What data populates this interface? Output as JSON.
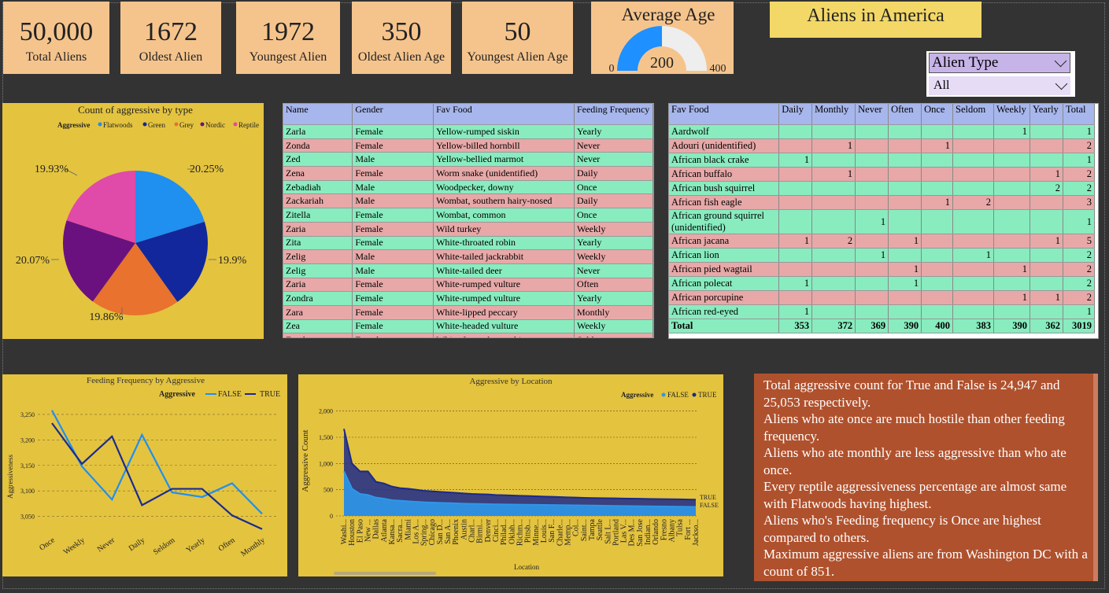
{
  "kpis": [
    {
      "value": "50,000",
      "label": "Total Aliens"
    },
    {
      "value": "1672",
      "label": "Oldest Alien"
    },
    {
      "value": "1972",
      "label": "Youngest Alien"
    },
    {
      "value": "350",
      "label": "Oldest Alien Age"
    },
    {
      "value": "50",
      "label": "Youngest Alien Age"
    }
  ],
  "gauge": {
    "title": "Average Age",
    "value": "200",
    "min": "0",
    "max": "400",
    "fraction": 0.5,
    "fill_color": "#1e90ff",
    "track_color": "#eeeeee"
  },
  "report_title": "Aliens in America",
  "slicer": {
    "label": "Alien Type",
    "selected": "All"
  },
  "pie": {
    "title": "Count of aggressive by type",
    "legend_title": "Aggressive",
    "labels": [
      "19.93%",
      "20.25%",
      "20.07%",
      "19.9%",
      "19.86%"
    ],
    "chart_data": {
      "type": "pie",
      "categories": [
        "Flatwoods",
        "Green",
        "Grey",
        "Nordic",
        "Reptile"
      ],
      "values": [
        20.25,
        19.9,
        19.86,
        20.07,
        19.93
      ],
      "colors": [
        "#1f8ff0",
        "#12279c",
        "#e8722e",
        "#6a117f",
        "#e04aa8"
      ]
    }
  },
  "table1": {
    "headers": [
      "Name",
      "Gender",
      "Fav Food",
      "Feeding Frequency"
    ],
    "rows": [
      [
        "Zarla",
        "Female",
        "Yellow-rumped siskin",
        "Yearly"
      ],
      [
        "Zonda",
        "Female",
        "Yellow-billed hornbill",
        "Never"
      ],
      [
        "Zed",
        "Male",
        "Yellow-bellied marmot",
        "Never"
      ],
      [
        "Zena",
        "Female",
        "Worm snake (unidentified)",
        "Daily"
      ],
      [
        "Zebadiah",
        "Male",
        "Woodpecker, downy",
        "Once"
      ],
      [
        "Zackariah",
        "Male",
        "Wombat, southern hairy-nosed",
        "Daily"
      ],
      [
        "Zitella",
        "Female",
        "Wombat, common",
        "Once"
      ],
      [
        "Zaria",
        "Female",
        "Wild turkey",
        "Weekly"
      ],
      [
        "Zita",
        "Female",
        "White-throated robin",
        "Yearly"
      ],
      [
        "Zelig",
        "Male",
        "White-tailed jackrabbit",
        "Weekly"
      ],
      [
        "Zelig",
        "Male",
        "White-tailed deer",
        "Never"
      ],
      [
        "Zaria",
        "Female",
        "White-rumped vulture",
        "Often"
      ],
      [
        "Zondra",
        "Female",
        "White-rumped vulture",
        "Yearly"
      ],
      [
        "Zara",
        "Female",
        "White-lipped peccary",
        "Monthly"
      ],
      [
        "Zea",
        "Female",
        "White-headed vulture",
        "Weekly"
      ],
      [
        "Zandra",
        "Female",
        "White-fronted capuchin",
        "Seldom"
      ]
    ]
  },
  "table2": {
    "headers": [
      "Fav Food",
      "Daily",
      "Monthly",
      "Never",
      "Often",
      "Once",
      "Seldom",
      "Weekly",
      "Yearly",
      "Total"
    ],
    "rows": [
      [
        "Aardwolf",
        "",
        "",
        "",
        "",
        "",
        "",
        "1",
        "",
        "1"
      ],
      [
        "Adouri (unidentified)",
        "",
        "1",
        "",
        "",
        "1",
        "",
        "",
        "",
        "2"
      ],
      [
        "African black crake",
        "1",
        "",
        "",
        "",
        "",
        "",
        "",
        "",
        "1"
      ],
      [
        "African buffalo",
        "",
        "1",
        "",
        "",
        "",
        "",
        "",
        "1",
        "2"
      ],
      [
        "African bush squirrel",
        "",
        "",
        "",
        "",
        "",
        "",
        "",
        "2",
        "2"
      ],
      [
        "African fish eagle",
        "",
        "",
        "",
        "",
        "1",
        "2",
        "",
        "",
        "3"
      ],
      [
        "African ground squirrel (unidentified)",
        "",
        "",
        "1",
        "",
        "",
        "",
        "",
        "",
        "1"
      ],
      [
        "African jacana",
        "1",
        "2",
        "",
        "1",
        "",
        "",
        "",
        "1",
        "5"
      ],
      [
        "African lion",
        "",
        "",
        "1",
        "",
        "",
        "1",
        "",
        "",
        "2"
      ],
      [
        "African pied wagtail",
        "",
        "",
        "",
        "1",
        "",
        "",
        "1",
        "",
        "2"
      ],
      [
        "African polecat",
        "1",
        "",
        "",
        "1",
        "",
        "",
        "",
        "",
        "2"
      ],
      [
        "African porcupine",
        "",
        "",
        "",
        "",
        "",
        "",
        "1",
        "1",
        "2"
      ],
      [
        "African red-eyed",
        "1",
        "",
        "",
        "",
        "",
        "",
        "",
        "",
        "1"
      ]
    ],
    "total": [
      "Total",
      "353",
      "372",
      "369",
      "390",
      "400",
      "383",
      "390",
      "362",
      "3019"
    ]
  },
  "line": {
    "title": "Feeding Frequency by Aggressive",
    "legend_title": "Aggressive",
    "ylabel": "Aggressiveness",
    "yticks": [
      "3,250",
      "3,200",
      "3,150",
      "3,100",
      "3,050"
    ],
    "chart_data": {
      "type": "line",
      "categories": [
        "Once",
        "Weekly",
        "Never",
        "Daily",
        "Seldom",
        "Yearly",
        "Often",
        "Monthly"
      ],
      "series": [
        {
          "name": "FALSE",
          "color": "#1f8ff0",
          "values": [
            3258,
            3148,
            3083,
            3210,
            3097,
            3088,
            3115,
            3055
          ]
        },
        {
          "name": "TRUE",
          "color": "#1a2c8f",
          "values": [
            3233,
            3153,
            3207,
            3072,
            3104,
            3104,
            3052,
            3025
          ]
        }
      ],
      "ylim": [
        3020,
        3270
      ]
    }
  },
  "area": {
    "title": "Aggressive by Location",
    "legend_title": "Aggressive",
    "ylabel": "Aggressive Count",
    "xlabel": "Location",
    "yticks": [
      "2,000",
      "1,500",
      "1,000",
      "500",
      "0"
    ],
    "end_labels": [
      "TRUE",
      "FALSE"
    ],
    "chart_data": {
      "type": "area",
      "categories": [
        "Washi...",
        "Houston",
        "El Paso",
        "New ...",
        "Dallas",
        "Atlanta",
        "Kansa...",
        "Sacra...",
        "Miami",
        "Los A...",
        "Spring...",
        "Chicago",
        "San D...",
        "San A...",
        "Phoenix",
        "Austin",
        "Charl...",
        "Birmi...",
        "Denver",
        "Cinci...",
        "Philad...",
        "Oklah...",
        "Richm...",
        "Pittsb...",
        "Minne...",
        "Louis...",
        "San F...",
        "Charle...",
        "Memp...",
        "Col...",
        "Saint...",
        "Tampa",
        "Seattle",
        "Salt L...",
        "Portland",
        "Las V...",
        "Des M...",
        "San Jose",
        "Indian...",
        "Orlando",
        "Fresno",
        "Albany",
        "Tulsa",
        "Fort ...",
        "Jackso..."
      ],
      "series": [
        {
          "name": "TRUE",
          "color": "#1c2a8a",
          "values": [
            1660,
            1000,
            850,
            850,
            650,
            620,
            560,
            530,
            520,
            500,
            480,
            470,
            460,
            450,
            440,
            430,
            420,
            415,
            410,
            400,
            395,
            390,
            385,
            380,
            375,
            370,
            365,
            360,
            355,
            350,
            345,
            342,
            340,
            338,
            335,
            332,
            330,
            328,
            325,
            322,
            320,
            318,
            316,
            314,
            312
          ]
        },
        {
          "name": "FALSE",
          "color": "#2f97e8",
          "values": [
            851,
            520,
            420,
            400,
            350,
            330,
            300,
            290,
            280,
            270,
            260,
            255,
            250,
            245,
            240,
            235,
            230,
            228,
            225,
            222,
            220,
            218,
            216,
            214,
            212,
            210,
            208,
            206,
            204,
            202,
            200,
            198,
            196,
            194,
            192,
            190,
            188,
            186,
            184,
            182,
            180,
            178,
            176,
            174,
            172
          ]
        }
      ],
      "ylim": [
        0,
        2100
      ]
    }
  },
  "insights": [
    "Total aggressive count for True and False is 24,947 and 25,053 respectively.",
    "Aliens who ate once are much hostile than other feeding frequency.",
    "Aliens who ate monthly are less aggressive than who ate once.",
    "Every reptile aggressiveness percentage are almost same with Flatwoods having highest.",
    "Aliens who's Feeding frequency is Once are highest compared to others.",
    "Maximum aggressive aliens are from Washington DC with a count of 851."
  ]
}
